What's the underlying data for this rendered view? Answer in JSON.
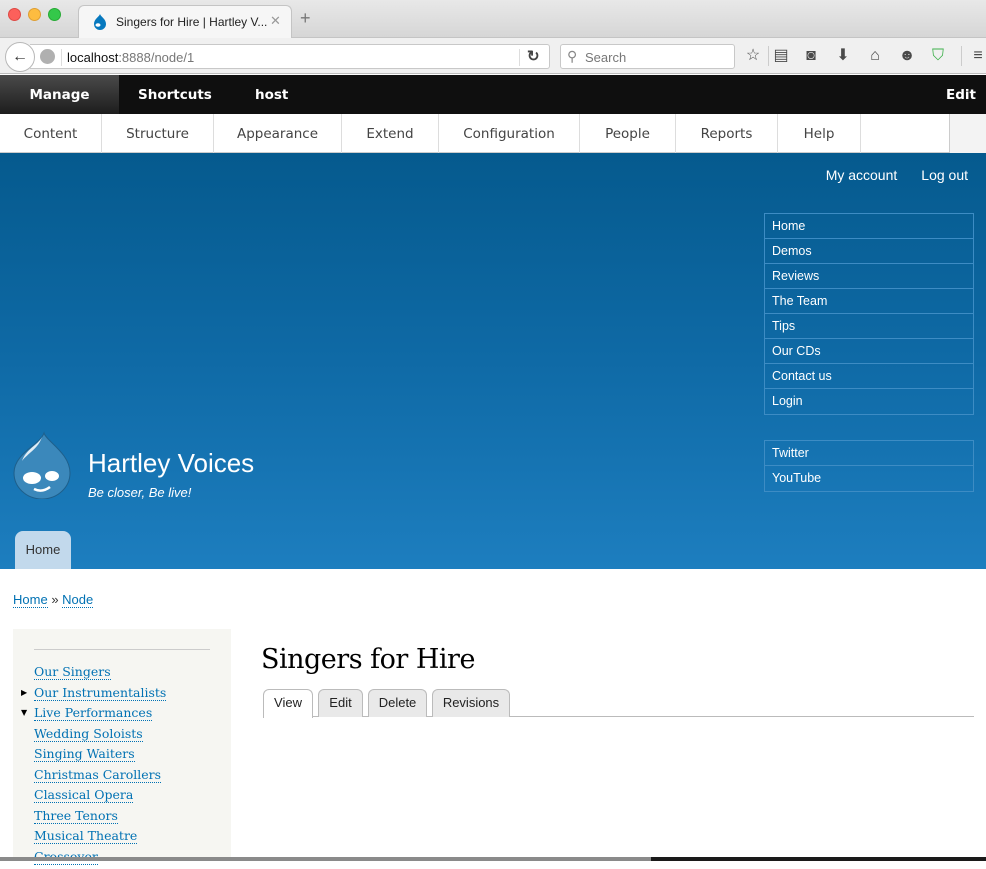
{
  "browser": {
    "tab_title": "Singers for Hire | Hartley V...",
    "url_host": "localhost",
    "url_rest": ":8888/node/1",
    "search_placeholder": "Search"
  },
  "toolbar": {
    "items": [
      "Manage",
      "Shortcuts",
      "host"
    ],
    "edit_label": "Edit",
    "tray": [
      "Content",
      "Structure",
      "Appearance",
      "Extend",
      "Configuration",
      "People",
      "Reports",
      "Help"
    ]
  },
  "header": {
    "secondary_menu": [
      "My account",
      "Log out"
    ],
    "main_menu": [
      "Home",
      "Demos",
      "Reviews",
      "The Team",
      "Tips",
      "Our CDs",
      "Contact us",
      "Login"
    ],
    "social_menu": [
      "Twitter",
      "YouTube"
    ],
    "site_name": "Hartley Voices",
    "slogan": "Be closer, Be live!",
    "primary_tab": "Home"
  },
  "breadcrumb": {
    "items": [
      "Home",
      "Node"
    ],
    "separator": "»"
  },
  "sidebar": {
    "items": [
      {
        "label": "Our Singers",
        "arrow": ""
      },
      {
        "label": "Our Instrumentalists",
        "arrow": "collapsed"
      },
      {
        "label": "Live Performances",
        "arrow": "expanded"
      },
      {
        "label": "Wedding Soloists",
        "arrow": ""
      },
      {
        "label": "Singing Waiters",
        "arrow": ""
      },
      {
        "label": "Christmas Carollers",
        "arrow": ""
      },
      {
        "label": "Classical Opera",
        "arrow": ""
      },
      {
        "label": "Three Tenors",
        "arrow": ""
      },
      {
        "label": "Musical Theatre",
        "arrow": ""
      },
      {
        "label": "Crossover",
        "arrow": ""
      }
    ]
  },
  "main": {
    "title": "Singers for Hire",
    "tabs": [
      "View",
      "Edit",
      "Delete",
      "Revisions"
    ],
    "active_tab": "View"
  },
  "colors": {
    "link": "#0071b3",
    "header_top": "#055a8e",
    "header_bottom": "#1d7ebf"
  }
}
